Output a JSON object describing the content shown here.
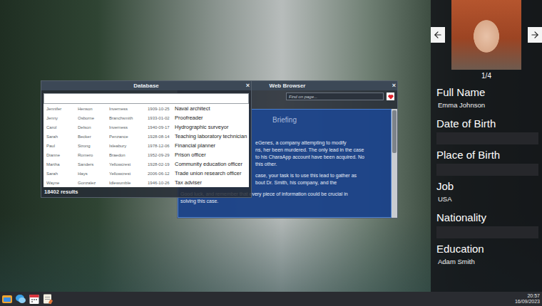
{
  "database": {
    "title": "Database",
    "close": "×",
    "results": "18402 results",
    "rows": [
      {
        "first": "Jennifer",
        "last": "Henson",
        "city": "Inverness",
        "date": "1909-10-25",
        "job": "Naval architect"
      },
      {
        "first": "Jenny",
        "last": "Osborne",
        "city": "Branchsmith",
        "date": "1933-01-02",
        "job": "Proofreader"
      },
      {
        "first": "Carol",
        "last": "Delson",
        "city": "Inverness",
        "date": "1940-09-17",
        "job": "Hydrographic surveyor"
      },
      {
        "first": "Sarah",
        "last": "Becker",
        "city": "Penzance",
        "date": "1928-08-14",
        "job": "Teaching laboratory technician"
      },
      {
        "first": "Paul",
        "last": "Strong",
        "city": "Isleabury",
        "date": "1978-12-06",
        "job": "Financial planner"
      },
      {
        "first": "Dianne",
        "last": "Romero",
        "city": "Braedon",
        "date": "1952-09-29",
        "job": "Prison officer"
      },
      {
        "first": "Martha",
        "last": "Sanders",
        "city": "Yellowcrest",
        "date": "1928-02-19",
        "job": "Community education officer"
      },
      {
        "first": "Sarah",
        "last": "Hays",
        "city": "Yellowcrest",
        "date": "2006-06-12",
        "job": "Trade union research officer"
      },
      {
        "first": "Wayne",
        "last": "Gonzalez",
        "city": "Idlewumble",
        "date": "1946-10-26",
        "job": "Tax adviser"
      }
    ]
  },
  "browser": {
    "title": "Web Browser",
    "close": "×",
    "find_placeholder": "Find on page...",
    "heading": "Briefing",
    "paragraphs": [
      {
        "lines": [
          {
            "text": "eGenes, a company attempting to modify",
            "kind": "clipped"
          },
          {
            "text": "ns, her been murdered. The only lead in the case",
            "kind": "clipped"
          },
          {
            "text": "to his CharaApp account have been acquired. No",
            "kind": "clipped"
          },
          {
            "text": "this other.",
            "kind": "clipped"
          }
        ]
      },
      {
        "lines": [
          {
            "text": "case, your task is to use this lead to gather as",
            "kind": "clipped"
          },
          {
            "text": "bout Dr. Smith, his company, and the",
            "kind": "clipped"
          }
        ]
      },
      {
        "lines": [
          {
            "text": "Good luck, and remember that every piece of information could be crucial in",
            "kind": "full"
          },
          {
            "text": "solving this case.",
            "kind": "full"
          }
        ]
      }
    ]
  },
  "profile": {
    "counter": "1/4",
    "fields": [
      {
        "label": "Full Name",
        "kind": "text",
        "value": "Emma Johnson"
      },
      {
        "label": "Date of Birth",
        "kind": "empty"
      },
      {
        "label": "Place of Birth",
        "kind": "empty"
      },
      {
        "label": "Job",
        "kind": "text",
        "value": "USA"
      },
      {
        "label": "Nationality",
        "kind": "empty"
      },
      {
        "label": "Education",
        "kind": "text",
        "value": "Adam Smith"
      }
    ]
  },
  "taskbar": {
    "time": "20:57",
    "date": "16/09/2023"
  }
}
